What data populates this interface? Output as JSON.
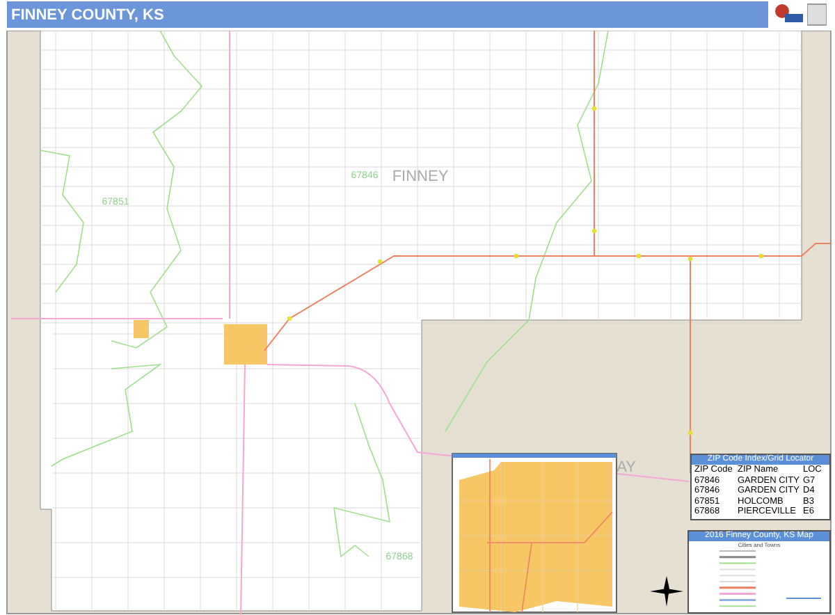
{
  "header": {
    "title": "FINNEY COUNTY, KS"
  },
  "map": {
    "labels": [
      {
        "kind": "county",
        "text": "FINNEY"
      },
      {
        "kind": "zip",
        "text": "67846"
      },
      {
        "kind": "zip",
        "text": "67851"
      },
      {
        "kind": "zip",
        "text": "67868"
      },
      {
        "kind": "county",
        "text": "AY"
      }
    ]
  },
  "zip_table": {
    "title": "ZIP Code Index/Grid Locator",
    "columns": [
      "ZIP Code",
      "ZIP Name",
      "LOC"
    ],
    "rows": [
      [
        "67846",
        "GARDEN CITY",
        "G7"
      ],
      [
        "67846",
        "GARDEN CITY",
        "D4"
      ],
      [
        "67851",
        "HOLCOMB",
        "B3"
      ],
      [
        "67868",
        "PIERCEVILLE",
        "E6"
      ]
    ]
  },
  "legend": {
    "title": "2016 Finney County, KS Map",
    "subtitle": "Cities and Towns"
  }
}
